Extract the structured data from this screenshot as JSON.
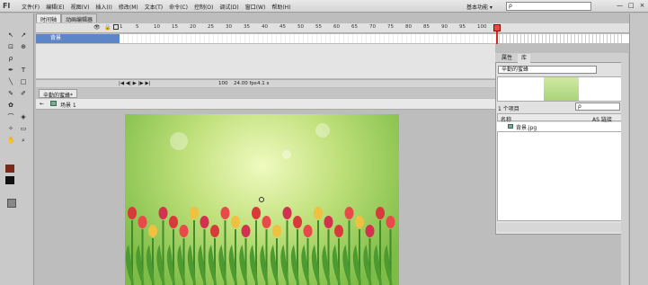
{
  "app": {
    "logo": "Fl",
    "workspace": "基本功能 ▾",
    "search_placeholder": "ρ"
  },
  "menu": [
    "文件(F)",
    "编辑(E)",
    "视图(V)",
    "插入(I)",
    "修改(M)",
    "文本(T)",
    "命令(C)",
    "控制(O)",
    "调试(D)",
    "窗口(W)",
    "帮助(H)"
  ],
  "window_buttons": [
    "—",
    "□",
    "×"
  ],
  "top_tabs": [
    "时间轴",
    "动画编辑器"
  ],
  "timeline": {
    "ruler": [
      "1",
      "5",
      "10",
      "15",
      "20",
      "25",
      "30",
      "35",
      "40",
      "45",
      "50",
      "55",
      "60",
      "65",
      "70",
      "75",
      "80",
      "85",
      "90",
      "95",
      "100"
    ],
    "layer_name": "背景",
    "footer": {
      "fps": "24.00 fps",
      "time": "4.1 s",
      "frame": "100"
    }
  },
  "document": {
    "tab": "辛勤的蜜蜂*",
    "scene": "场景 1"
  },
  "library": {
    "tabs": [
      "属性",
      "库"
    ],
    "selected_doc": "辛勤的蜜蜂",
    "item_count": "1 个项目",
    "columns": [
      "名称",
      "AS 链接"
    ],
    "items": [
      {
        "name": "背景.jpg"
      }
    ]
  },
  "colors": {
    "selection": "#5d86c8",
    "playhead": "#d22",
    "stroke": "#7a2a1a",
    "fill": "#111111"
  }
}
